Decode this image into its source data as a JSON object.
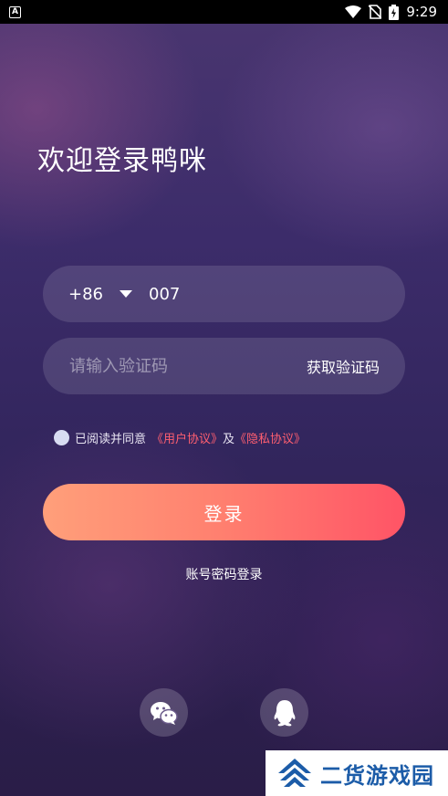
{
  "status_bar": {
    "app_icon_letter": "A",
    "time": "9:29"
  },
  "welcome_title": "欢迎登录鸭咪",
  "phone": {
    "country_code": "+86",
    "value": "007"
  },
  "verification": {
    "placeholder": "请输入验证码",
    "get_code_label": "获取验证码"
  },
  "agreement": {
    "prefix": "已阅读并同意",
    "user_agreement": "《用户协议》",
    "conjunction": "及",
    "privacy_policy": "《隐私协议》",
    "link_color": "#ff5f70"
  },
  "login_button_label": "登录",
  "password_login_label": "账号密码登录",
  "social_logins": [
    {
      "icon": "wechat-icon"
    },
    {
      "icon": "qq-icon"
    }
  ],
  "watermark": {
    "text": "二货游戏园"
  },
  "colors": {
    "accent_start": "#ff9f7a",
    "accent_end": "#ff5466"
  }
}
